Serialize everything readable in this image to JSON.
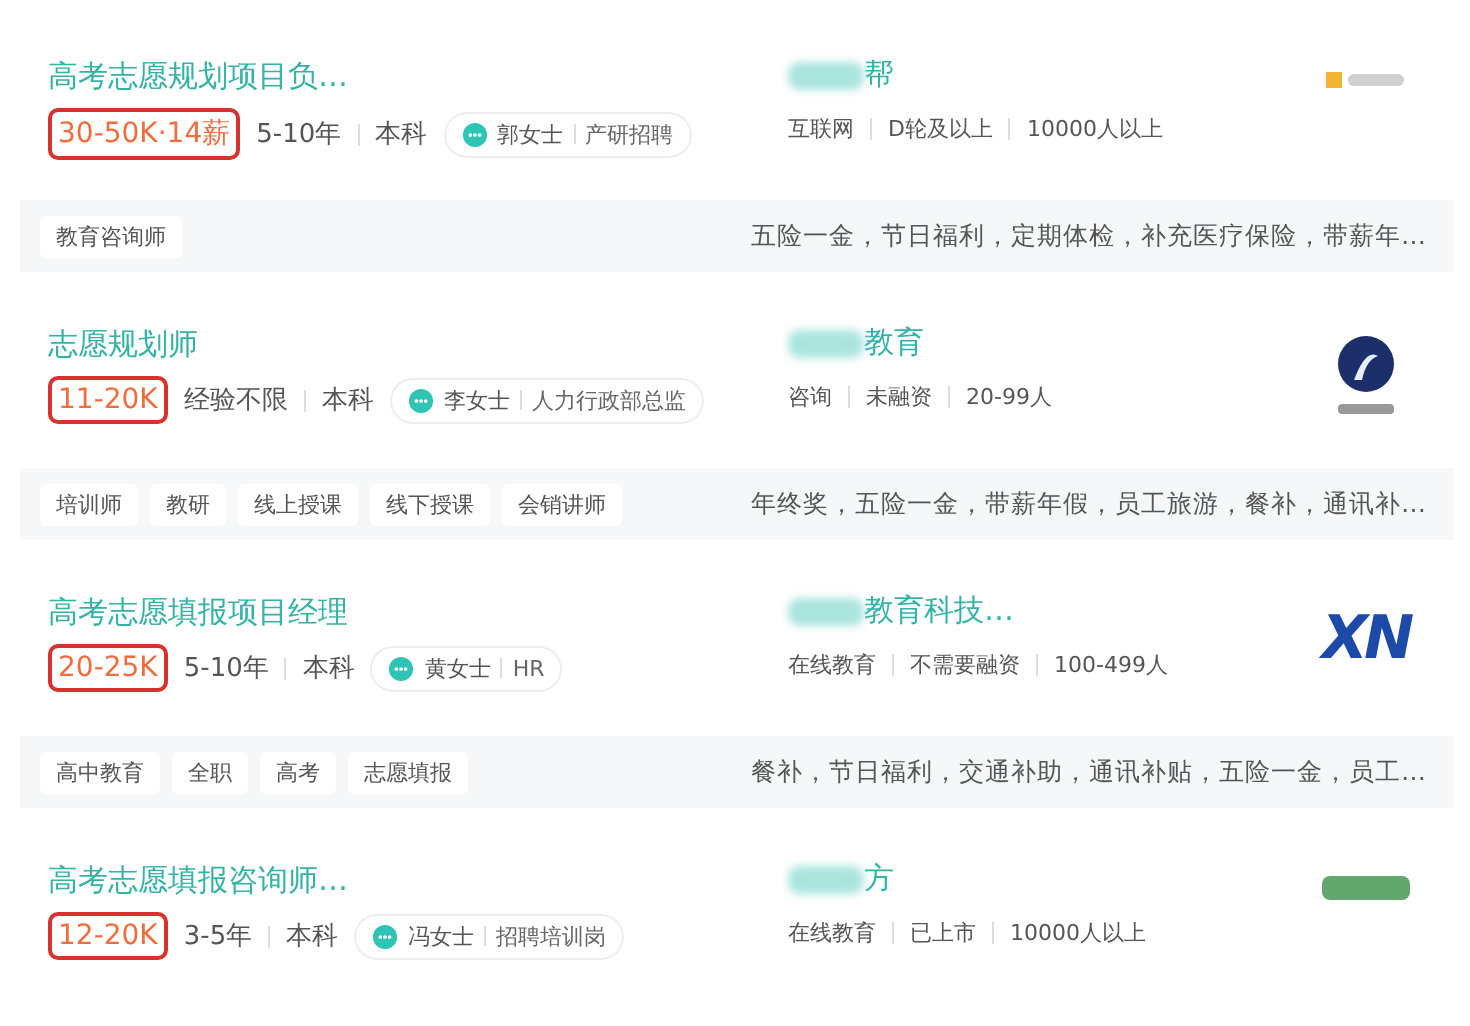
{
  "jobs": [
    {
      "title": "高考志愿规划项目负…",
      "salary": "30-50K·14薪",
      "experience": "5-10年",
      "education": "本科",
      "recruiter": {
        "name": "郭女士",
        "role": "产研招聘"
      },
      "company": {
        "name": "帮",
        "blurred_prefix": true,
        "tags": [
          "互联网",
          "D轮及以上",
          "10000人以上"
        ],
        "logo": {
          "kind": "badge"
        }
      },
      "skills": [
        "教育咨询师"
      ],
      "benefits": "五险一金，节日福利，定期体检，补充医疗保险，带薪年…"
    },
    {
      "title": "志愿规划师",
      "salary": "11-20K",
      "experience": "经验不限",
      "education": "本科",
      "recruiter": {
        "name": "李女士",
        "role": "人力行政部总监"
      },
      "company": {
        "name": "教育",
        "blurred_prefix": true,
        "tags": [
          "咨询",
          "未融资",
          "20-99人"
        ],
        "logo": {
          "kind": "emblem"
        }
      },
      "skills": [
        "培训师",
        "教研",
        "线上授课",
        "线下授课",
        "会销讲师"
      ],
      "benefits": "年终奖，五险一金，带薪年假，员工旅游，餐补，通讯补…"
    },
    {
      "title": "高考志愿填报项目经理",
      "salary": "20-25K",
      "experience": "5-10年",
      "education": "本科",
      "recruiter": {
        "name": "黄女士",
        "role": "HR"
      },
      "company": {
        "name": "教育科技…",
        "blurred_prefix": true,
        "tags": [
          "在线教育",
          "不需要融资",
          "100-499人"
        ],
        "logo": {
          "kind": "lettermark",
          "text": "XN"
        }
      },
      "skills": [
        "高中教育",
        "全职",
        "高考",
        "志愿填报"
      ],
      "benefits": "餐补，节日福利，交通补助，通讯补贴，五险一金，员工…"
    },
    {
      "title": "高考志愿填报咨询师…",
      "salary": "12-20K",
      "experience": "3-5年",
      "education": "本科",
      "recruiter": {
        "name": "冯女士",
        "role": "招聘培训岗"
      },
      "company": {
        "name": "方",
        "blurred_prefix": true,
        "tags": [
          "在线教育",
          "已上市",
          "10000人以上"
        ],
        "logo": {
          "kind": "wordmark"
        }
      }
    }
  ]
}
